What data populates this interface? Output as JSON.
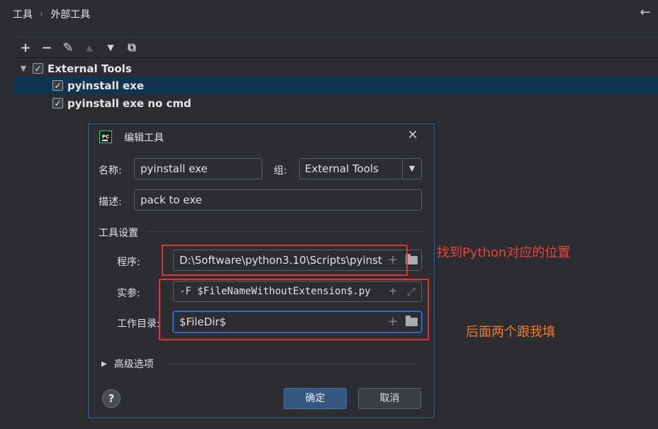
{
  "header": {
    "breadcrumb": [
      "工具",
      "外部工具"
    ],
    "breadcrumb_separator": "›",
    "back_icon": "←"
  },
  "toolbar": {
    "icons": [
      "add-icon",
      "remove-icon",
      "edit-icon",
      "move-up-icon",
      "move-down-icon",
      "copy-icon"
    ],
    "add": "+",
    "remove": "−",
    "edit": "✎",
    "up": "▲",
    "down": "▼",
    "copy": "⧉"
  },
  "tree": {
    "group_label": "External Tools",
    "items": [
      {
        "label": "pyinstall exe",
        "checked": true,
        "selected": true
      },
      {
        "label": "pyinstall exe no cmd",
        "checked": true,
        "selected": false
      }
    ],
    "check_mark": "✓",
    "expand_arrow": "▼"
  },
  "dialog": {
    "title": "编辑工具",
    "app_icon_text": "PC",
    "close_icon": "✕",
    "name_label": "名称:",
    "name_value": "pyinstall exe",
    "group_label": "组:",
    "group_value": "External Tools",
    "group_arrow": "▼",
    "desc_label": "描述:",
    "desc_value": "pack to exe",
    "tool_settings_label": "工具设置",
    "program_label": "程序:",
    "program_value": "D:\\Software\\python3.10\\Scripts\\pyinst",
    "args_label": "实参:",
    "args_value": "-F $FileNameWithoutExtension$.py",
    "workdir_label": "工作目录:",
    "workdir_value": "$FileDir$",
    "advanced_label": "高级选项",
    "advanced_arrow": "▶",
    "plus": "+",
    "expand": "⤢",
    "ok_label": "确定",
    "cancel_label": "取消",
    "help_label": "?"
  },
  "annotations": {
    "program_note": "找到Python对应的位置",
    "rest_note": "后面两个跟我填",
    "note_color_1": "#e8453c",
    "note_color_2": "#f07b2e",
    "box_color": "#e03434"
  },
  "colors": {
    "background": "#2b2d30",
    "selection": "#0f3450",
    "accent": "#3574f0",
    "ok_button": "#365880"
  }
}
